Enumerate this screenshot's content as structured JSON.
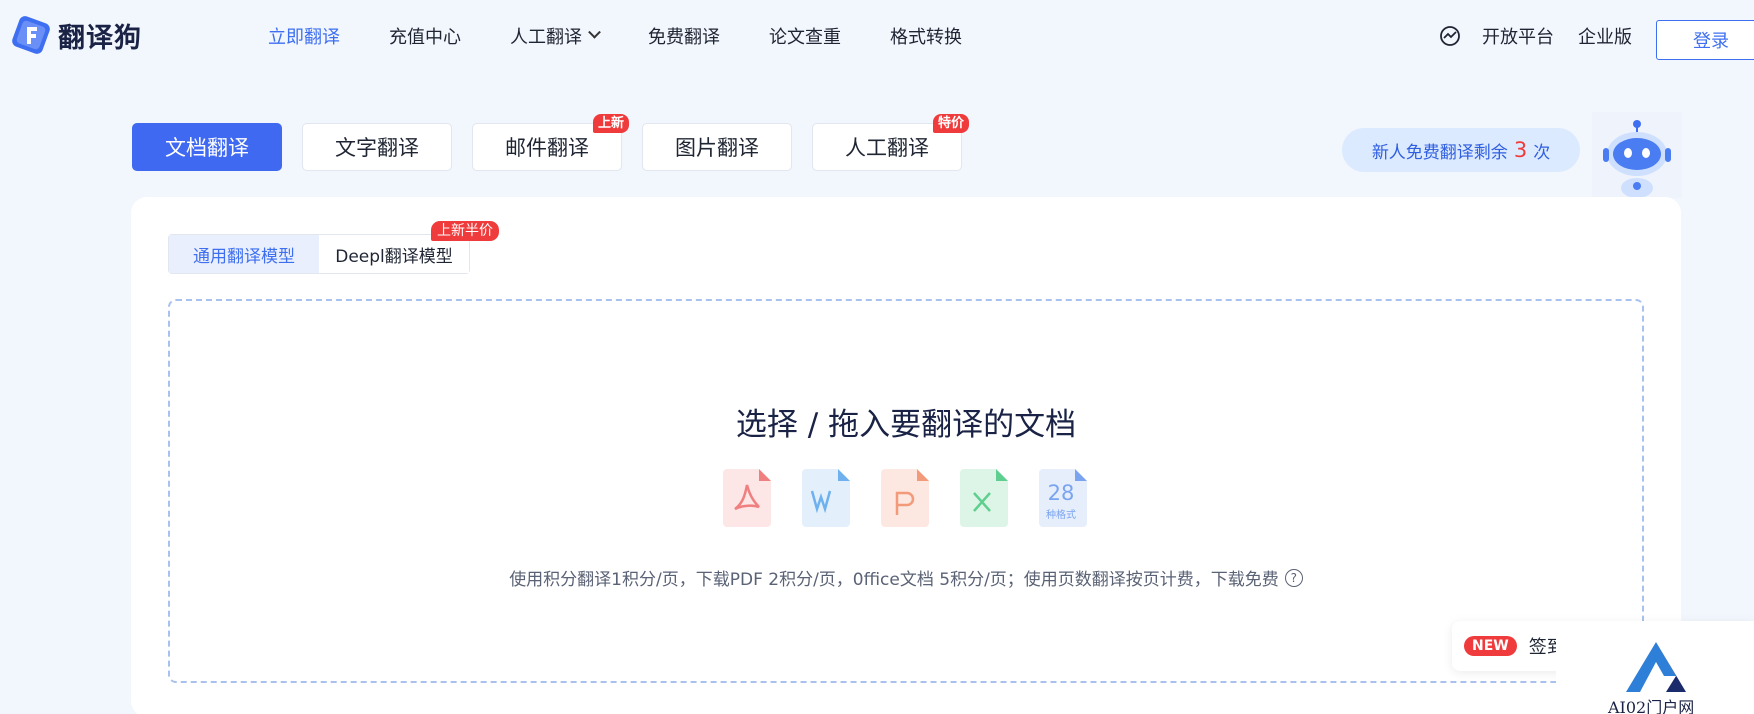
{
  "header": {
    "brand": "翻译狗",
    "nav": [
      {
        "label": "立即翻译",
        "active": true
      },
      {
        "label": "充值中心"
      },
      {
        "label": "人工翻译",
        "dropdown": true
      },
      {
        "label": "免费翻译"
      },
      {
        "label": "论文查重"
      },
      {
        "label": "格式转换"
      }
    ],
    "right": {
      "platform": "开放平台",
      "enterprise": "企业版",
      "login": "登录"
    }
  },
  "tabs": [
    {
      "label": "文档翻译",
      "active": true
    },
    {
      "label": "文字翻译"
    },
    {
      "label": "邮件翻译",
      "badge": "上新"
    },
    {
      "label": "图片翻译"
    },
    {
      "label": "人工翻译",
      "badge": "特价"
    }
  ],
  "promo": {
    "prefix": "新人免费翻译剩余",
    "count": "3",
    "suffix": "次"
  },
  "model_tabs": [
    {
      "label": "通用翻译模型",
      "active": true
    },
    {
      "label": "Deepl翻译模型",
      "badge": "上新半价"
    }
  ],
  "upload": {
    "title": "选择 / 拖入要翻译的文档",
    "formats_count": "28",
    "formats_label": "种格式",
    "note": "使用积分翻译1积分/页，下载PDF 2积分/页，0ffice文档 5积分/页；使用页数翻译按页计费，下载免费"
  },
  "signin": {
    "badge": "NEW",
    "text": "签到"
  },
  "watermark": "AI02门户网",
  "colors": {
    "accent": "#4069f1",
    "badge_red": "#ef3b3b",
    "pdf": "#f07f7f",
    "word": "#6fb1ee",
    "ppt": "#f39a7a",
    "excel": "#5fcf8f",
    "more": "#7aa4f0"
  }
}
